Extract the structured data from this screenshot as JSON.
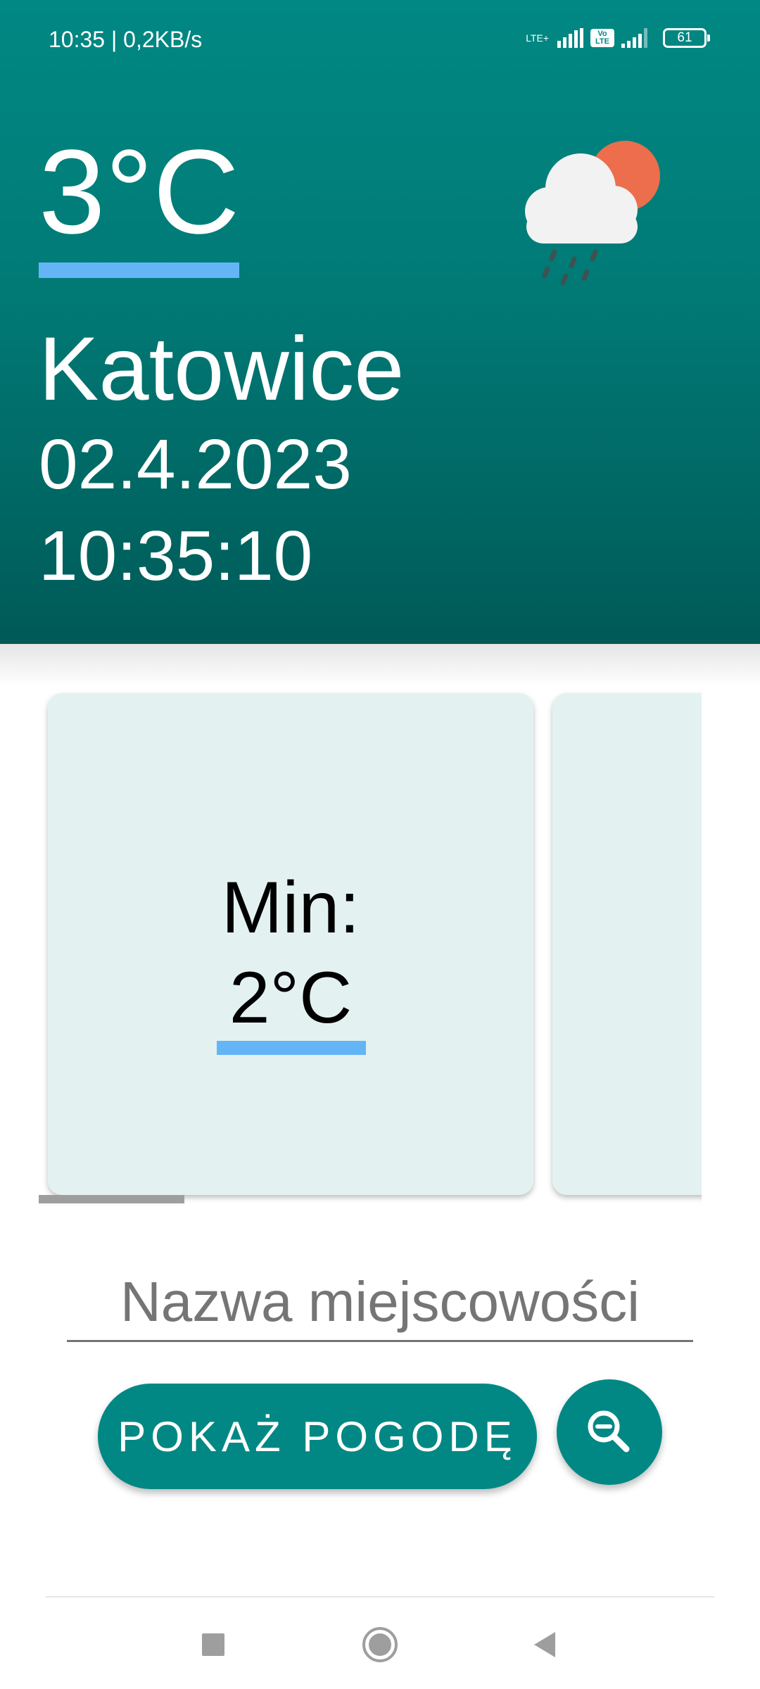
{
  "status_bar": {
    "time_text": "10:35 | 0,2KB/s",
    "network_label": "LTE+",
    "volte_label": "Vo LTE",
    "battery_level": "61"
  },
  "weather": {
    "temperature": "3°C",
    "city": "Katowice",
    "date": "02.4.2023",
    "time": "10:35:10",
    "icon": "cloud-sun-rain-icon"
  },
  "cards": [
    {
      "label": "Min:",
      "value": "2°C"
    }
  ],
  "search": {
    "placeholder": "Nazwa miejscowości",
    "value": "",
    "button_label": "POKAŻ POGODĘ",
    "fab_icon": "zoom-out-icon"
  },
  "navigation": {
    "items": [
      "recents-icon",
      "home-icon",
      "back-icon"
    ]
  },
  "colors": {
    "primary": "#018884",
    "accent": "#64b5f6",
    "card_background": "#e3f2f1",
    "sun": "#ec6e4c"
  }
}
